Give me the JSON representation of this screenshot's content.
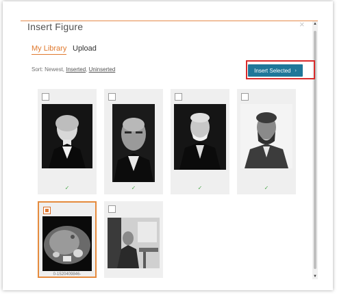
{
  "dialog": {
    "title": "Insert Figure",
    "close_icon": "×"
  },
  "tabs": [
    {
      "label": "My Library",
      "active": true
    },
    {
      "label": "Upload",
      "active": false
    }
  ],
  "sort": {
    "prefix": "Sort: Newest, ",
    "options": [
      "Inserted",
      "Uninserted"
    ],
    "separator": ", "
  },
  "insert_button": {
    "label": "Insert Selected",
    "icon": "›"
  },
  "figures": [
    {
      "name": "portrait-1",
      "checked": false,
      "inserted": true,
      "inserted_icon": "✓"
    },
    {
      "name": "portrait-2",
      "checked": false,
      "inserted": true,
      "inserted_icon": "✓"
    },
    {
      "name": "portrait-3",
      "checked": false,
      "inserted": true,
      "inserted_icon": "✓"
    },
    {
      "name": "portrait-4",
      "checked": false,
      "inserted": true,
      "inserted_icon": "✓"
    },
    {
      "name": "ct-scan",
      "checked": true,
      "inserted": false,
      "caption": "0-1520409846-"
    },
    {
      "name": "lab-photo",
      "checked": false,
      "inserted": false
    }
  ],
  "scroll": {
    "up_icon": "▲",
    "down_icon": "▼"
  },
  "colors": {
    "accent": "#e0792d",
    "button": "#1f7799",
    "highlight": "#d82a2a",
    "check": "#4aa84a"
  }
}
